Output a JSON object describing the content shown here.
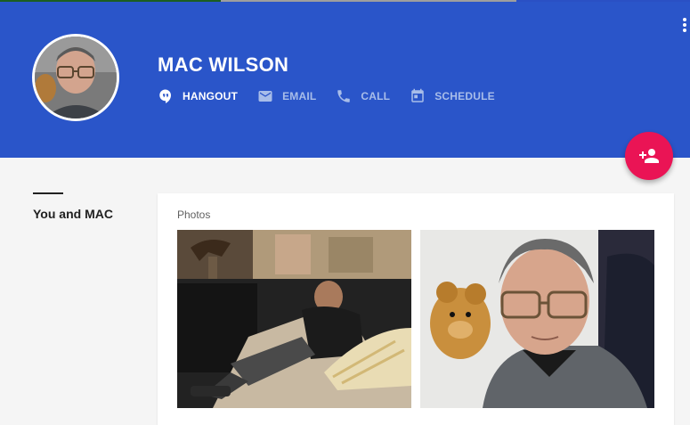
{
  "header": {
    "name": "MAC WILSON",
    "accent_color": "#2a55c9",
    "actions": [
      {
        "label": "HANGOUT",
        "icon": "hangout-icon",
        "active": true
      },
      {
        "label": "EMAIL",
        "icon": "email-icon",
        "active": false
      },
      {
        "label": "CALL",
        "icon": "phone-icon",
        "active": false
      },
      {
        "label": "SCHEDULE",
        "icon": "calendar-icon",
        "active": false
      }
    ],
    "menu_icon": "more-vert-icon"
  },
  "fab": {
    "icon": "add-person-icon",
    "color": "#ea1455"
  },
  "sidebar": {
    "title": "You and MAC"
  },
  "photos": {
    "title": "Photos",
    "items": [
      {
        "name": "photo-man-reclining-on-couch"
      },
      {
        "name": "photo-man-with-glasses-and-teddy-bear"
      }
    ]
  }
}
